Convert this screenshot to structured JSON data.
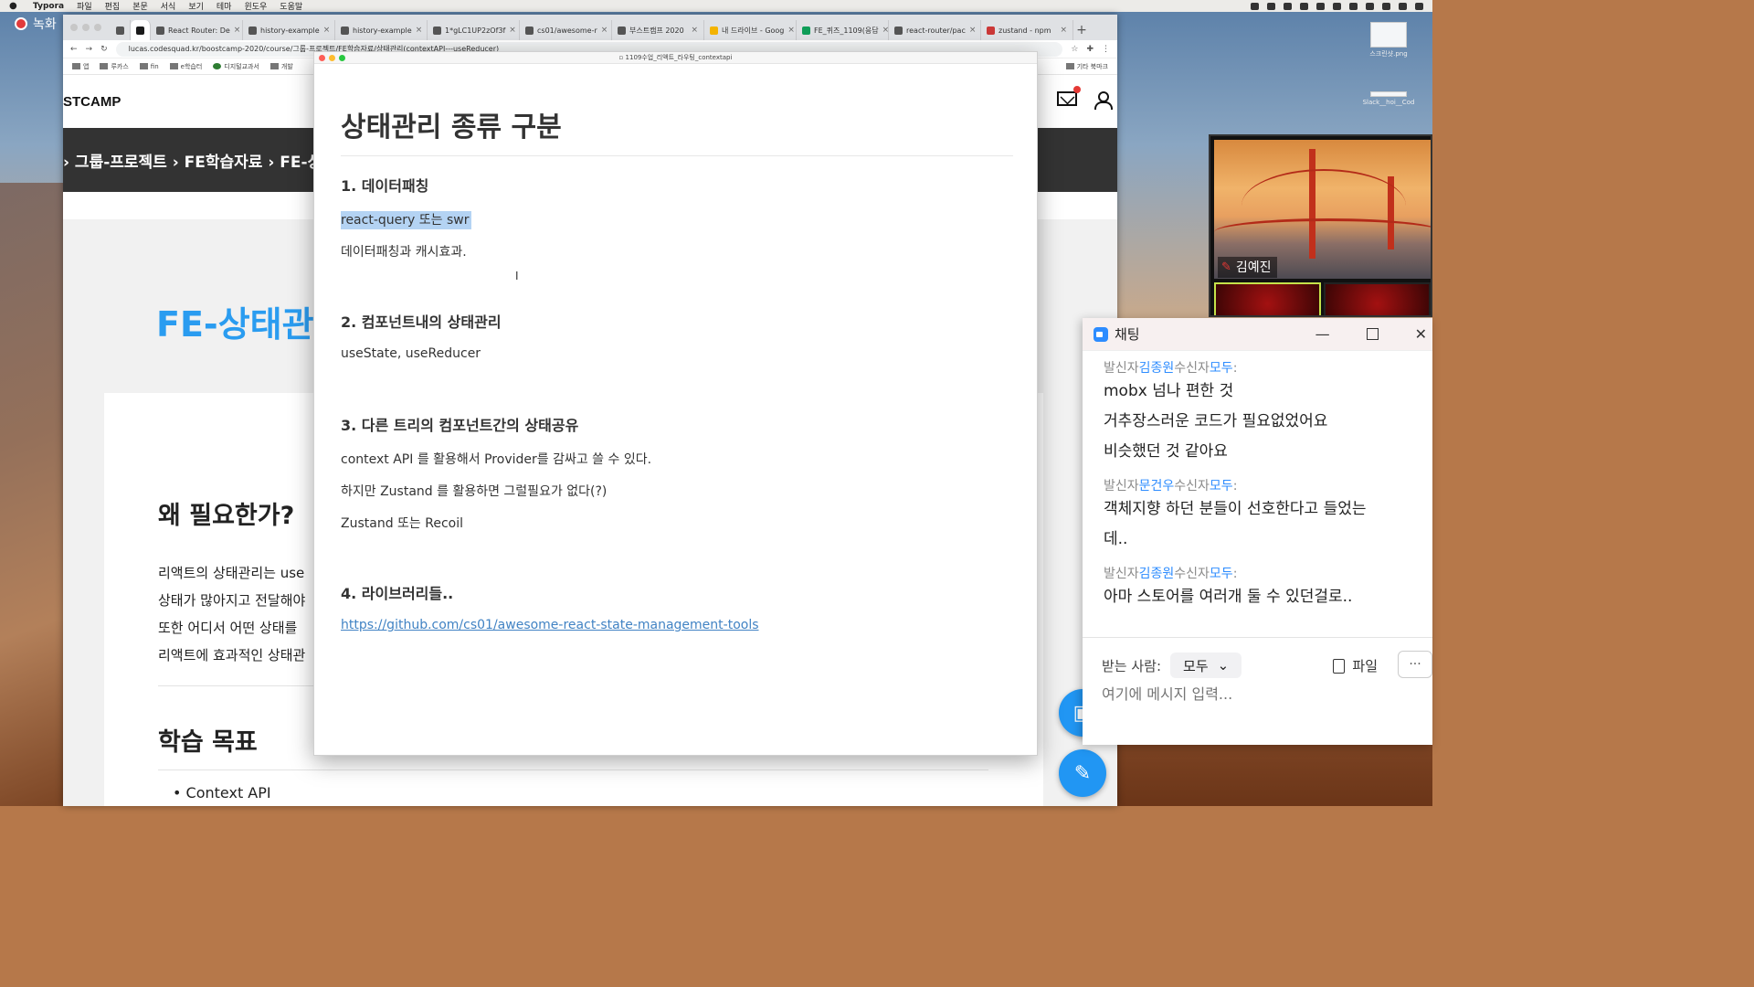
{
  "menubar": {
    "app": "Typora",
    "items": [
      "파일",
      "편집",
      "본문",
      "서식",
      "보기",
      "테마",
      "윈도우",
      "도움말"
    ]
  },
  "recording": {
    "label": "녹화"
  },
  "desktop_files": [
    {
      "name": "스크린샷.png"
    },
    {
      "name": "Slack__hoi__Cod"
    }
  ],
  "browser": {
    "tabs": [
      {
        "label": "React Router: De"
      },
      {
        "label": "history-example"
      },
      {
        "label": "history-example"
      },
      {
        "label": "1*gLC1UP2zOf3f"
      },
      {
        "label": "cs01/awesome-r"
      },
      {
        "label": "부스트캠프 2020"
      },
      {
        "label": "내 드라이브 - Goog"
      },
      {
        "label": "FE_퀴즈_1109(응답"
      },
      {
        "label": "react-router/pac"
      },
      {
        "label": "zustand - npm"
      }
    ],
    "url": "lucas.codesquad.kr/boostcamp-2020/course/그룹-프로젝트/FE학습자료/상태관리(contextAPI---useReducer)",
    "bookmarks": [
      "앱",
      "루카스",
      "fin",
      "e학습터",
      "디지털교과서",
      "개발"
    ],
    "bookmarks_right": "기타 북마크"
  },
  "site": {
    "brand": "STCAMP",
    "breadcrumb": "› 그룹-프로젝트 › FE학습자료 › FE-상",
    "big_title": "FE-상태관",
    "why_heading": "왜 필요한가?",
    "why_lines": [
      "리액트의 상태관리는 use",
      "상태가 많아지고 전달해야",
      "또한 어디서 어떤 상태를",
      "리액트에 효과적인 상태관"
    ],
    "goal_heading": "학습 목표",
    "goal_items": [
      "Context API"
    ]
  },
  "typora": {
    "window_title": "1109수업_리액트_라우팅_contextapi",
    "h1": "상태관리 종류 구분",
    "sections": [
      {
        "heading": "1. 데이터패칭",
        "lines": [
          "react-query 또는 swr",
          "데이터패칭과 캐시효과."
        ]
      },
      {
        "heading": "2. 컴포넌트내의 상태관리",
        "lines": [
          "useState, useReducer"
        ]
      },
      {
        "heading": "3. 다른 트리의 컴포넌트간의 상태공유",
        "lines": [
          "context API 를 활용해서 Provider를 감싸고 쓸 수 있다.",
          "하지만 Zustand 를 활용하면 그럴필요가 없다(?)",
          "Zustand 또는 Recoil"
        ]
      },
      {
        "heading": "4. 라이브러리들..",
        "link": "https://github.com/cs01/awesome-react-state-management-tools"
      }
    ]
  },
  "video": {
    "participant": "김예진"
  },
  "chat": {
    "title": "채팅",
    "prefix_from": "발신자",
    "prefix_to": "수신자",
    "messages": [
      {
        "sender": "김종원",
        "recipient": "모두",
        "lines": [
          "mobx 넘나 편한 것",
          "거추장스러운 코드가 필요없었어요",
          "비슷했던 것 같아요"
        ]
      },
      {
        "sender": "문건우",
        "recipient": "모두",
        "lines": [
          "객체지향 하던 분들이 선호한다고 들었는",
          "데.."
        ]
      },
      {
        "sender": "김종원",
        "recipient": "모두",
        "lines": [
          "아마 스토어를 여러개 둘 수 있던걸로.."
        ]
      }
    ],
    "to_label": "받는 사람:",
    "to_value": "모두",
    "file_label": "파일",
    "more_label": "···",
    "input_placeholder": "여기에 메시지 입력..."
  }
}
